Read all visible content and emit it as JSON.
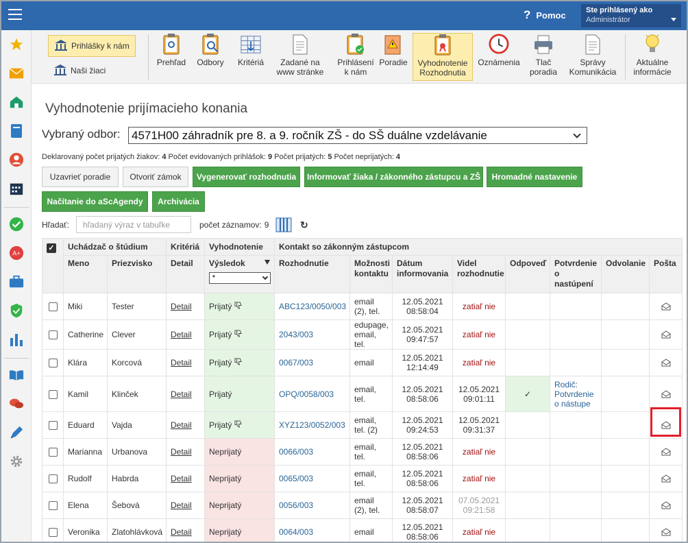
{
  "header": {
    "help_label": "Pomoc",
    "user_line1": "Ste prihlásený ako",
    "user_line2": "Administrátor"
  },
  "toolbar": {
    "left_items": [
      "Prihlášky k nám",
      "Naši žiaci"
    ],
    "buttons": [
      {
        "label1": "Prehľad",
        "label2": ""
      },
      {
        "label1": "Odbory",
        "label2": ""
      },
      {
        "label1": "Kritériá",
        "label2": ""
      },
      {
        "label1": "Zadané na",
        "label2": "www stránke"
      },
      {
        "label1": "Prihlásení",
        "label2": "k nám"
      },
      {
        "label1": "Poradie",
        "label2": ""
      },
      {
        "label1": "Vyhodnotenie",
        "label2": "Rozhodnutia"
      },
      {
        "label1": "Oznámenia",
        "label2": ""
      },
      {
        "label1": "Tlač",
        "label2": "poradia"
      },
      {
        "label1": "Správy",
        "label2": "Komunikácia"
      },
      {
        "label1": "Aktuálne",
        "label2": "informácie"
      }
    ]
  },
  "page": {
    "title": "Vyhodnotenie prijímacieho konania",
    "odbor_label": "Vybraný odbor:",
    "odbor_value": "4571H00 záhradník pre 8. a 9. ročník ZŠ - do SŠ duálne vzdelávanie"
  },
  "stats": {
    "l1": "Deklarovaný počet prijatých žiakov:",
    "v1": "4",
    "l2": "Počet evidovaných prihlášok:",
    "v2": "9",
    "l3": "Počet prijatých:",
    "v3": "5",
    "l4": "Počet neprijatých:",
    "v4": "4"
  },
  "actions": {
    "uzavriet": "Uzavrieť poradie",
    "otvorit": "Otvoriť zámok",
    "vygenerovat": "Vygenerovať rozhodnutia",
    "informovat": "Informovať žiaka / zákonného zástupcu a ZŠ",
    "hromadne": "Hromadné nastavenie",
    "nacitanie": "Načítanie do aScAgendy",
    "archivacia": "Archivácia"
  },
  "search": {
    "label": "Hľadať:",
    "placeholder": "hľadaný výraz v tabuľke",
    "count_label": "počet záznamov:",
    "count": "9"
  },
  "table": {
    "group_headers": [
      "Uchádzač o štúdium",
      "Kritériá",
      "Vyhodnotenie",
      "Kontakt so zákonným zástupcom"
    ],
    "headers": {
      "meno": "Meno",
      "priezvisko": "Priezvisko",
      "detail": "Detail",
      "vysledok": "Výsledok",
      "rozhodnutie": "Rozhodnutie",
      "moznosti": "Možnosti kontaktu",
      "datum": "Dátum informovania",
      "videl": "Videl rozhodnutie",
      "odpoved": "Odpoveď",
      "potvrdenie": "Potvrdenie o nastúpení",
      "odvolanie": "Odvolanie",
      "posta": "Pošta"
    },
    "filter_value": "*",
    "rows": [
      {
        "meno": "Miki",
        "priezvisko": "Tester",
        "detail": "Detail",
        "vysledok": "Prijatý",
        "rozhodnutie": "ABC123/0050/003",
        "moznosti": "email (2), tel.",
        "datum1": "12.05.2021",
        "datum2": "08:58:04",
        "videl1": "zatiaľ nie",
        "videl2": "",
        "odpoved": "",
        "potvrdenie": "",
        "odvolanie": ""
      },
      {
        "meno": "Catherine",
        "priezvisko": "Clever",
        "detail": "Detail",
        "vysledok": "Prijatý",
        "rozhodnutie": "2043/003",
        "moznosti": "edupage, email, tel.",
        "datum1": "12.05.2021",
        "datum2": "09:47:57",
        "videl1": "zatiaľ nie",
        "videl2": "",
        "odpoved": "",
        "potvrdenie": "",
        "odvolanie": ""
      },
      {
        "meno": "Klára",
        "priezvisko": "Korcová",
        "detail": "Detail",
        "vysledok": "Prijatý",
        "rozhodnutie": "0067/003",
        "moznosti": "email",
        "datum1": "12.05.2021",
        "datum2": "12:14:49",
        "videl1": "zatiaľ nie",
        "videl2": "",
        "odpoved": "",
        "potvrdenie": "",
        "odvolanie": ""
      },
      {
        "meno": "Kamil",
        "priezvisko": "Klinček",
        "detail": "Detail",
        "vysledok": "Prijatý",
        "rozhodnutie": "OPQ/0058/003",
        "moznosti": "email, tel.",
        "datum1": "12.05.2021",
        "datum2": "08:58:06",
        "videl1": "12.05.2021",
        "videl2": "09:01:11",
        "odpoved": "✓",
        "potvrdenie": "Rodič: Potvrdenie o nástupe",
        "odvolanie": ""
      },
      {
        "meno": "Eduard",
        "priezvisko": "Vajda",
        "detail": "Detail",
        "vysledok": "Prijatý",
        "rozhodnutie": "XYZ123/0052/003",
        "moznosti": "email, tel. (2)",
        "datum1": "12.05.2021",
        "datum2": "09:24:53",
        "videl1": "12.05.2021",
        "videl2": "09:31:37",
        "odpoved": "",
        "potvrdenie": "",
        "odvolanie": ""
      },
      {
        "meno": "Marianna",
        "priezvisko": "Urbanova",
        "detail": "Detail",
        "vysledok": "Neprijatý",
        "rozhodnutie": "0066/003",
        "moznosti": "email, tel.",
        "datum1": "12.05.2021",
        "datum2": "08:58:06",
        "videl1": "zatiaľ nie",
        "videl2": "",
        "odpoved": "",
        "potvrdenie": "",
        "odvolanie": ""
      },
      {
        "meno": "Rudolf",
        "priezvisko": "Habrda",
        "detail": "Detail",
        "vysledok": "Neprijatý",
        "rozhodnutie": "0065/003",
        "moznosti": "email, tel.",
        "datum1": "12.05.2021",
        "datum2": "08:58:06",
        "videl1": "zatiaľ nie",
        "videl2": "",
        "odpoved": "",
        "potvrdenie": "",
        "odvolanie": ""
      },
      {
        "meno": "Elena",
        "priezvisko": "Šebová",
        "detail": "Detail",
        "vysledok": "Neprijatý",
        "rozhodnutie": "0056/003",
        "moznosti": "email (2), tel.",
        "datum1": "12.05.2021",
        "datum2": "08:58:07",
        "videl1": "07.05.2021",
        "videl2": "09:21:58",
        "odpoved": "",
        "potvrdenie": "",
        "odvolanie": ""
      },
      {
        "meno": "Veronika",
        "priezvisko": "Zlatohlávková",
        "detail": "Detail",
        "vysledok": "Neprijatý",
        "rozhodnutie": "0064/003",
        "moznosti": "email",
        "datum1": "12.05.2021",
        "datum2": "08:58:06",
        "videl1": "zatiaľ nie",
        "videl2": "",
        "odpoved": "",
        "potvrdenie": "",
        "odvolanie": ""
      }
    ]
  },
  "colors": {
    "topbar": "#2e68ad",
    "accept_bg": "#e4f5e4",
    "reject_bg": "#fae3e3",
    "green_button": "#4ba34b",
    "highlight": "#e0202a"
  }
}
